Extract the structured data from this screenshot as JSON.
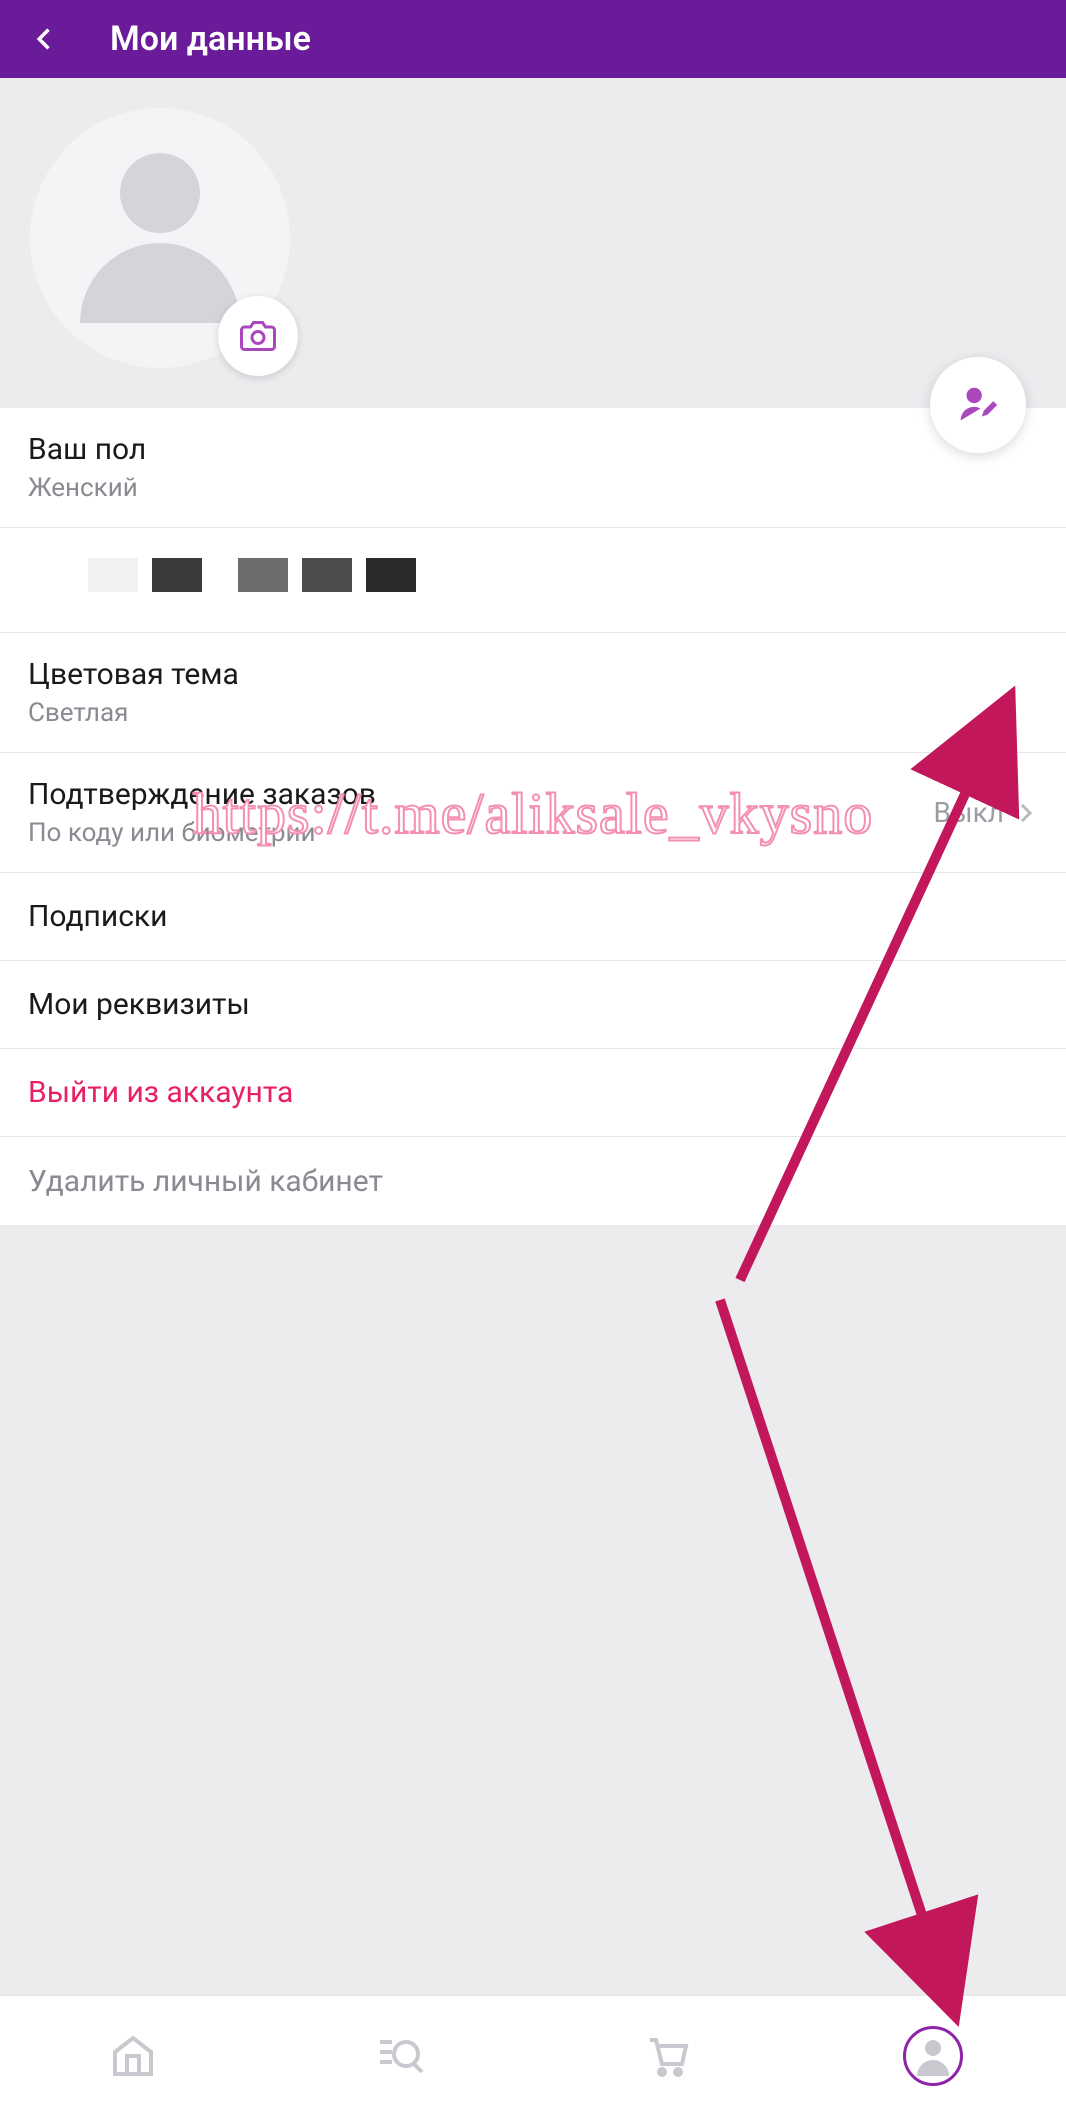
{
  "header": {
    "title": "Мои данные"
  },
  "gender": {
    "label": "Ваш пол",
    "value": "Женский"
  },
  "theme": {
    "label": "Цветовая тема",
    "value": "Светлая"
  },
  "confirm": {
    "label": "Подтверждение заказов",
    "sub": "По коду или биометрии",
    "state": "Выкл"
  },
  "subs": {
    "label": "Подписки"
  },
  "reqs": {
    "label": "Мои реквизиты"
  },
  "logout": {
    "label": "Выйти из аккаунта"
  },
  "delete": {
    "label": "Удалить личный кабинет"
  },
  "watermark": "https://t.me/aliksale_vkysno"
}
